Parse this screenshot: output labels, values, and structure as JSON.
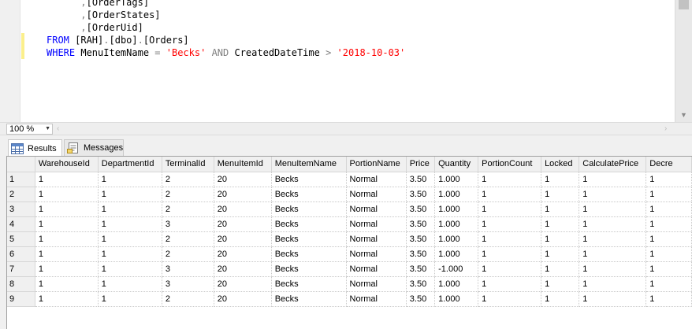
{
  "editor": {
    "lines": [
      [
        {
          "t": "      ",
          "c": "plain"
        },
        {
          "t": ",",
          "c": "punc"
        },
        {
          "t": "[OrderTags]",
          "c": "plain"
        }
      ],
      [
        {
          "t": "      ",
          "c": "plain"
        },
        {
          "t": ",",
          "c": "punc"
        },
        {
          "t": "[OrderStates]",
          "c": "plain"
        }
      ],
      [
        {
          "t": "      ",
          "c": "plain"
        },
        {
          "t": ",",
          "c": "punc"
        },
        {
          "t": "[OrderUid]",
          "c": "plain"
        }
      ],
      [
        {
          "t": "FROM",
          "c": "kw"
        },
        {
          "t": " [RAH]",
          "c": "plain"
        },
        {
          "t": ".",
          "c": "punc"
        },
        {
          "t": "[dbo]",
          "c": "plain"
        },
        {
          "t": ".",
          "c": "punc"
        },
        {
          "t": "[Orders]",
          "c": "plain"
        }
      ],
      [
        {
          "t": "WHERE",
          "c": "kw"
        },
        {
          "t": " MenuItemName ",
          "c": "plain"
        },
        {
          "t": "=",
          "c": "punc"
        },
        {
          "t": " ",
          "c": "plain"
        },
        {
          "t": "'Becks'",
          "c": "str"
        },
        {
          "t": " ",
          "c": "plain"
        },
        {
          "t": "AND",
          "c": "punc"
        },
        {
          "t": " CreatedDateTime ",
          "c": "plain"
        },
        {
          "t": ">",
          "c": "punc"
        },
        {
          "t": " ",
          "c": "plain"
        },
        {
          "t": "'2018-10-03'",
          "c": "str"
        }
      ]
    ]
  },
  "zoom": {
    "value": "100 %"
  },
  "tabs": {
    "results": "Results",
    "messages": "Messages"
  },
  "grid": {
    "columns": [
      "WarehouseId",
      "DepartmentId",
      "TerminalId",
      "MenuItemId",
      "MenuItemName",
      "PortionName",
      "Price",
      "Quantity",
      "PortionCount",
      "Locked",
      "CalculatePrice",
      "Decre"
    ],
    "rows": [
      {
        "num": "1",
        "cells": [
          "1",
          "1",
          "2",
          "20",
          "Becks",
          "Normal",
          "3.50",
          "1.000",
          "1",
          "1",
          "1",
          "1"
        ]
      },
      {
        "num": "2",
        "cells": [
          "1",
          "1",
          "2",
          "20",
          "Becks",
          "Normal",
          "3.50",
          "1.000",
          "1",
          "1",
          "1",
          "1"
        ]
      },
      {
        "num": "3",
        "cells": [
          "1",
          "1",
          "2",
          "20",
          "Becks",
          "Normal",
          "3.50",
          "1.000",
          "1",
          "1",
          "1",
          "1"
        ]
      },
      {
        "num": "4",
        "cells": [
          "1",
          "1",
          "3",
          "20",
          "Becks",
          "Normal",
          "3.50",
          "1.000",
          "1",
          "1",
          "1",
          "1"
        ]
      },
      {
        "num": "5",
        "cells": [
          "1",
          "1",
          "2",
          "20",
          "Becks",
          "Normal",
          "3.50",
          "1.000",
          "1",
          "1",
          "1",
          "1"
        ]
      },
      {
        "num": "6",
        "cells": [
          "1",
          "1",
          "2",
          "20",
          "Becks",
          "Normal",
          "3.50",
          "1.000",
          "1",
          "1",
          "1",
          "1"
        ]
      },
      {
        "num": "7",
        "cells": [
          "1",
          "1",
          "3",
          "20",
          "Becks",
          "Normal",
          "3.50",
          "-1.000",
          "1",
          "1",
          "1",
          "1"
        ]
      },
      {
        "num": "8",
        "cells": [
          "1",
          "1",
          "3",
          "20",
          "Becks",
          "Normal",
          "3.50",
          "1.000",
          "1",
          "1",
          "1",
          "1"
        ]
      },
      {
        "num": "9",
        "cells": [
          "1",
          "1",
          "2",
          "20",
          "Becks",
          "Normal",
          "3.50",
          "1.000",
          "1",
          "1",
          "1",
          "1"
        ]
      }
    ]
  },
  "icons": {
    "results_tab": "grid-icon",
    "messages_tab": "messages-icon"
  },
  "colors": {
    "keyword": "#0000ff",
    "string": "#ff0000",
    "operator": "#808080",
    "change_bar": "#fbef8c"
  }
}
